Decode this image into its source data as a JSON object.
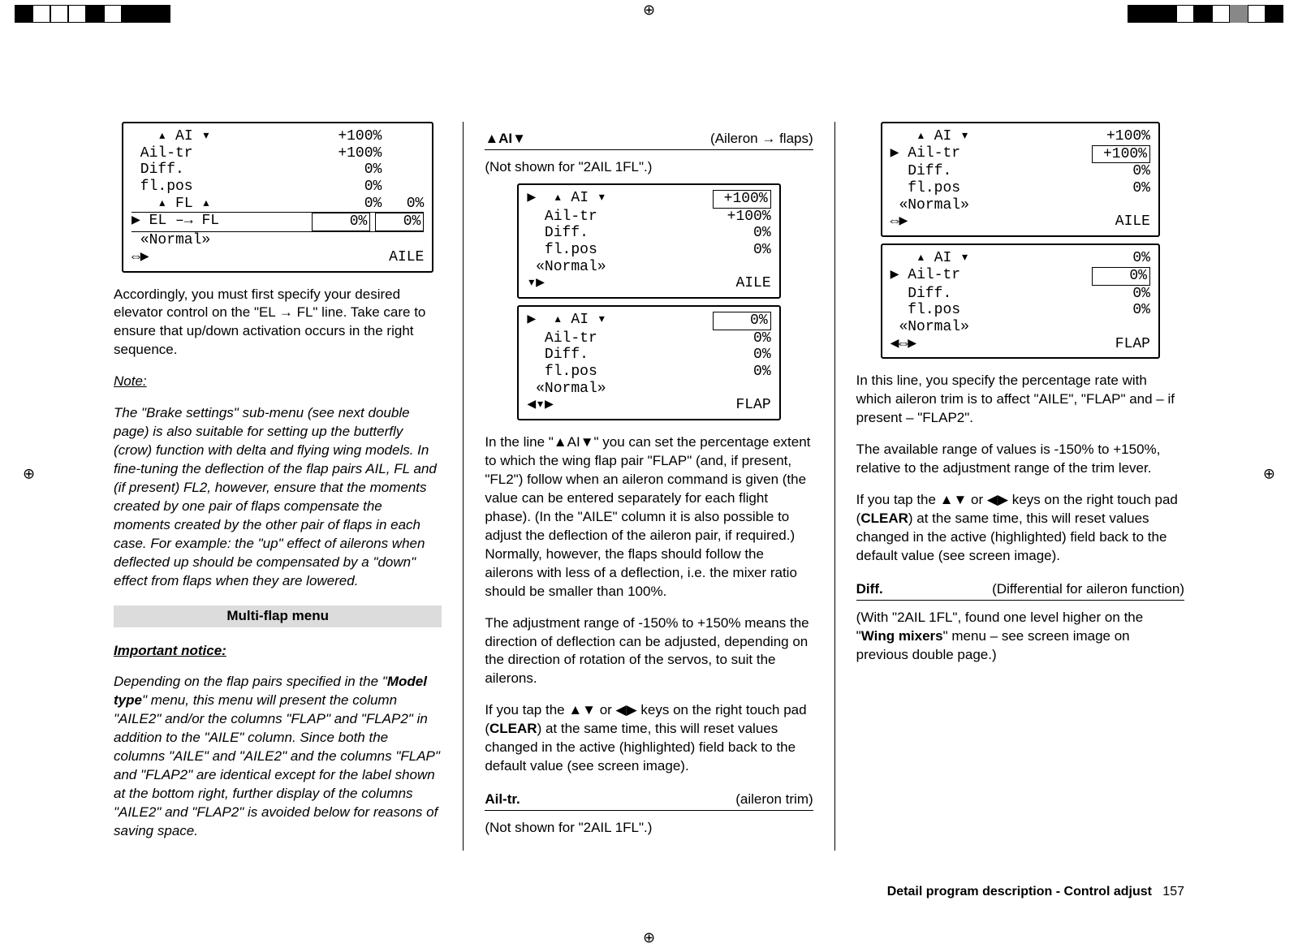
{
  "registration": {
    "top": "⊕",
    "bottom": "⊕",
    "left": "⊕",
    "right": "⊕"
  },
  "col1": {
    "screen1": {
      "rows": [
        {
          "lab": "   ▴ AI ▾",
          "v1": "+100%",
          "v2": ""
        },
        {
          "lab": " Ail-tr",
          "v1": "+100%",
          "v2": ""
        },
        {
          "lab": " Diff.",
          "v1": "0%",
          "v2": ""
        },
        {
          "lab": " fl.pos",
          "v1": "0%",
          "v2": ""
        },
        {
          "lab": "   ▴ FL ▴",
          "v1": "0%",
          "v2": "0%"
        },
        {
          "lab": "▶ EL –→ FL",
          "v1": "0%",
          "v2": "0%",
          "boxed": true
        },
        {
          "lab": " «Normal»",
          "v1": "",
          "v2": ""
        }
      ],
      "foot_left": "⇔▶",
      "foot_right": "AILE"
    },
    "p1": "Accordingly, you must first specify your desired elevator control on the \"EL → FL\" line. Take care to ensure that up/down activation occurs in the right sequence.",
    "noteLabel": "Note:",
    "noteBody": "The \"Brake settings\" sub-menu (see next double page) is also suitable for setting up the butterfly (crow) function with delta and flying wing models. In fine-tuning the deflection of the flap pairs AIL, FL and (if present) FL2, however, ensure that the moments created by one pair of flaps compensate the moments created by the other pair of flaps in each case. For example: the \"up\" effect of ailerons when deflected up should be compensated by a \"down\" effect from flaps when they are lowered.",
    "subhead": "Multi-flap menu",
    "impLabel": "Important notice:",
    "impBody1": "Depending on the flap pairs specified in the \"",
    "impBold": "Model type",
    "impBody2": "\" menu, this menu will present the column \"AILE2\" and/or the columns \"FLAP\" and \"FLAP2\" in addition to the \"AILE\" column. Since both the columns \"AILE\" and \"AILE2\" and the columns \"FLAP\" and \"FLAP2\" are identical except for the label shown at the bottom right, further display of the columns \"AILE2\" and \"FLAP2\" is avoided below for reasons of saving space."
  },
  "col2": {
    "hdr_term": "▲AI▼",
    "hdr_desc": "(Aileron → flaps)",
    "sub": "(Not shown for \"2AIL 1FL\".)",
    "screenA": {
      "rows": [
        {
          "lab": "▶  ▴ AI ▾",
          "v": "+100%",
          "boxed": true
        },
        {
          "lab": "  Ail-tr",
          "v": "+100%"
        },
        {
          "lab": "  Diff.",
          "v": "0%"
        },
        {
          "lab": "  fl.pos",
          "v": "0%"
        },
        {
          "lab": " «Normal»",
          "v": ""
        }
      ],
      "foot_left": "▾▶",
      "foot_right": "AILE"
    },
    "screenB": {
      "rows": [
        {
          "lab": "▶  ▴ AI ▾",
          "v": "0%",
          "boxed": true
        },
        {
          "lab": "  Ail-tr",
          "v": "0%"
        },
        {
          "lab": "  Diff.",
          "v": "0%"
        },
        {
          "lab": "  fl.pos",
          "v": "0%"
        },
        {
          "lab": " «Normal»",
          "v": ""
        }
      ],
      "foot_left": "◀▾▶",
      "foot_right": "FLAP"
    },
    "p1": "In the line \"▲AI▼\" you can set the percentage extent to which the wing flap pair \"FLAP\" (and, if present, \"FL2\") follow when an aileron command is given (the value can be entered separately for each flight phase). (In the \"AILE\" column it is also possible to adjust the deflection of the aileron pair, if required.) Normally, however, the flaps should follow the ailerons with less of a deflection, i.e. the mixer ratio should be smaller than 100%.",
    "p2": "The adjustment range of -150% to +150% means the direction of deflection can be adjusted, depending on the direction of rotation of the servos, to suit the ailerons.",
    "p3a": "If you tap the ▲▼ or ◀▶ keys on the right touch pad (",
    "p3b": "CLEAR",
    "p3c": ") at the same time, this will reset values changed in the active (highlighted) field back to the default value (see screen image).",
    "def_term": "Ail-tr.",
    "def_desc": "(aileron trim)",
    "sub2": "(Not shown for \"2AIL 1FL\".)"
  },
  "col3": {
    "screenA": {
      "rows": [
        {
          "lab": "   ▴ AI ▾",
          "v": "+100%"
        },
        {
          "lab": "▶ Ail-tr",
          "v": "+100%",
          "boxed": true
        },
        {
          "lab": "  Diff.",
          "v": "0%"
        },
        {
          "lab": "  fl.pos",
          "v": "0%"
        },
        {
          "lab": " «Normal»",
          "v": ""
        }
      ],
      "foot_left": "⇔▶",
      "foot_right": "AILE"
    },
    "screenB": {
      "rows": [
        {
          "lab": "   ▴ AI ▾",
          "v": "0%"
        },
        {
          "lab": "▶ Ail-tr",
          "v": "0%",
          "boxed": true
        },
        {
          "lab": "  Diff.",
          "v": "0%"
        },
        {
          "lab": "  fl.pos",
          "v": "0%"
        },
        {
          "lab": " «Normal»",
          "v": ""
        }
      ],
      "foot_left": "◀⇔▶",
      "foot_right": "FLAP"
    },
    "p1": "In this line, you specify the percentage rate with which aileron trim is to affect \"AILE\", \"FLAP\" and – if present – \"FLAP2\".",
    "p2": "The available range of values is -150% to +150%, relative to the adjustment range of the trim lever.",
    "p3a": "If you tap the ▲▼ or ◀▶ keys on the right touch pad (",
    "p3b": "CLEAR",
    "p3c": ") at the same time, this will reset values changed in the active (highlighted) field back to the default value (see screen image).",
    "def_term": "Diff.",
    "def_desc": "(Differential for aileron function)",
    "p4a": "(With \"2AIL 1FL\", found one level higher on the \"",
    "p4b": "Wing mixers",
    "p4c": "\" menu – see screen image on previous double page.)"
  },
  "footer": {
    "label": "Detail program description - Control adjust",
    "page": "157"
  }
}
